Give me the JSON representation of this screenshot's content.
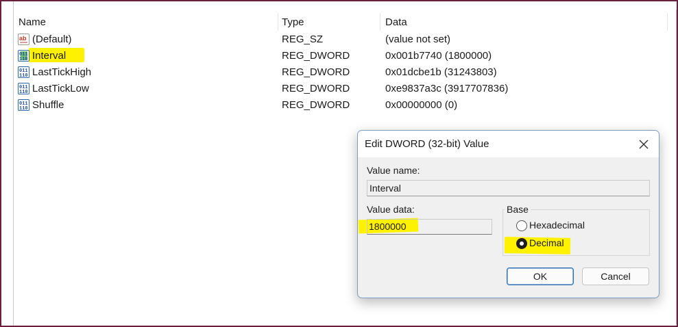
{
  "columns": {
    "name": "Name",
    "type": "Type",
    "data": "Data"
  },
  "rows": [
    {
      "name": "(Default)",
      "type": "REG_SZ",
      "data": "(value not set)",
      "icon": "string-value-icon"
    },
    {
      "name": "Interval",
      "type": "REG_DWORD",
      "data": "0x001b7740 (1800000)",
      "icon": "binary-value-icon"
    },
    {
      "name": "LastTickHigh",
      "type": "REG_DWORD",
      "data": "0x01dcbe1b (31243803)",
      "icon": "binary-value-icon"
    },
    {
      "name": "LastTickLow",
      "type": "REG_DWORD",
      "data": "0xe9837a3c (3917707836)",
      "icon": "binary-value-icon"
    },
    {
      "name": "Shuffle",
      "type": "REG_DWORD",
      "data": "0x00000000 (0)",
      "icon": "binary-value-icon"
    }
  ],
  "dialog": {
    "title": "Edit DWORD (32-bit) Value",
    "value_name_label": "Value name:",
    "value_name": "Interval",
    "value_data_label": "Value data:",
    "value_data": "1800000",
    "base_label": "Base",
    "base_options": [
      "Hexadecimal",
      "Decimal"
    ],
    "base_selected": "Decimal",
    "ok_label": "OK",
    "cancel_label": "Cancel"
  },
  "colors": {
    "highlight": "#fff200",
    "frame": "#6b1f3f",
    "accent": "#2d6fb8"
  }
}
